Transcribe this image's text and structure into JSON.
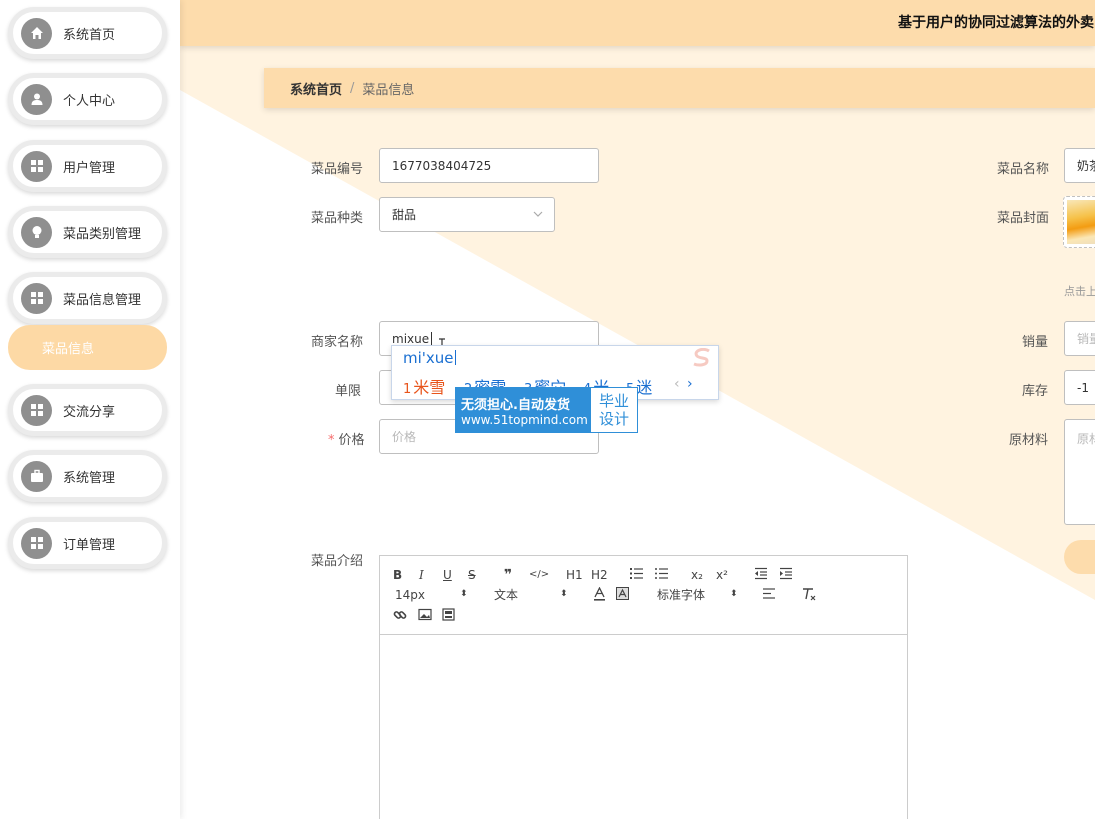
{
  "colors": {
    "accent": "#fddcac",
    "accent_light": "#fff3e0",
    "active_sub": "#fdd9a5",
    "required": "#f56c6c",
    "ime_blue": "#1a6fd1",
    "ime_first": "#e8541b"
  },
  "header": {
    "title": "基于用户的协同过滤算法的外卖"
  },
  "sidebar": {
    "items": [
      {
        "label": "系统首页",
        "icon": "home-icon"
      },
      {
        "label": "个人中心",
        "icon": "user-icon"
      },
      {
        "label": "用户管理",
        "icon": "grid-icon"
      },
      {
        "label": "菜品类别管理",
        "icon": "bulb-icon"
      },
      {
        "label": "菜品信息管理",
        "icon": "grid-icon"
      },
      {
        "label": "交流分享",
        "icon": "grid-icon"
      },
      {
        "label": "系统管理",
        "icon": "briefcase-icon"
      },
      {
        "label": "订单管理",
        "icon": "grid-icon"
      }
    ],
    "active_sub": "菜品信息"
  },
  "breadcrumb": {
    "home": "系统首页",
    "sep": "/",
    "current": "菜品信息"
  },
  "form": {
    "dish_code": {
      "label": "菜品编号",
      "value": "1677038404725"
    },
    "dish_name": {
      "label": "菜品名称",
      "value": "奶茶"
    },
    "dish_category": {
      "label": "菜品种类",
      "value": "甜品"
    },
    "dish_cover": {
      "label": "菜品封面",
      "hint": "点击上传"
    },
    "merchant": {
      "label": "商家名称",
      "value": "mixue"
    },
    "sales": {
      "label": "销量",
      "placeholder": "销量"
    },
    "limit": {
      "label": "单限"
    },
    "stock": {
      "label": "库存",
      "value": "-1"
    },
    "price": {
      "label": "价格",
      "required_mark": "*",
      "placeholder": "价格"
    },
    "ingredients": {
      "label": "原材料",
      "placeholder": "原材料"
    },
    "intro": {
      "label": "菜品介绍"
    }
  },
  "editor": {
    "toolbar_row1": [
      "B",
      "I",
      "U",
      "S",
      "❞",
      "</>",
      "H1",
      "H2",
      "ol",
      "ul",
      "x₂",
      "x²",
      "outdent",
      "indent"
    ],
    "font_size": "14px",
    "text_type": "文本",
    "font_family": "标准字体"
  },
  "ime": {
    "pinyin": "mi'xue",
    "candidates": [
      {
        "n": "1",
        "text": "米雪"
      },
      {
        "n": "2",
        "text": "密雪"
      },
      {
        "n": "3",
        "text": "蜜穴"
      },
      {
        "n": "4",
        "text": "米"
      },
      {
        "n": "5",
        "text": "迷"
      }
    ],
    "prev": "‹",
    "next": "›"
  },
  "watermark": {
    "line1": "无须担心.自动发货",
    "line2": "www.51topmind.com",
    "right1": "毕业",
    "right2": "设计"
  }
}
